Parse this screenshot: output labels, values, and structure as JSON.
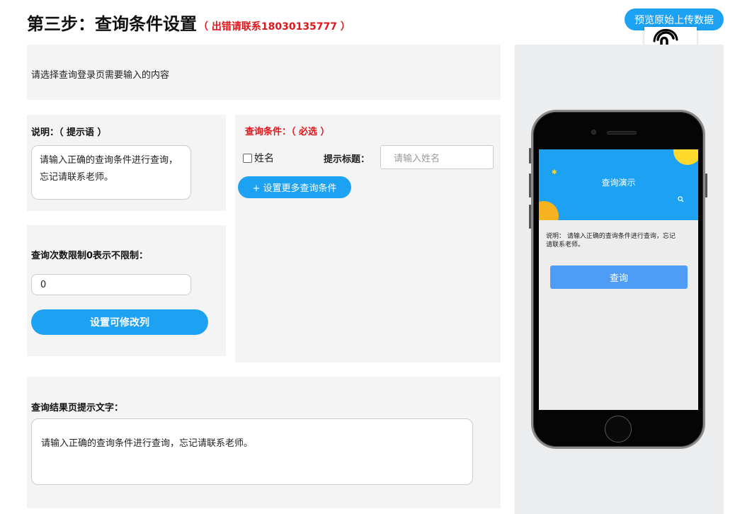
{
  "header": {
    "title": "第三步：查询条件设置",
    "note": "（ 出错请联系18030135777 ）",
    "preview_button": "预览原始上传数据"
  },
  "intro": {
    "text": "请选择查询登录页需要输入的内容"
  },
  "description": {
    "label": "说明：（ 提示语 ）",
    "value": "请输入正确的查询条件进行查询，忘记请联系老师。"
  },
  "limit": {
    "label": "查询次数限制0表示不限制：",
    "value": "0",
    "set_columns_button": "设置可修改列"
  },
  "conditions": {
    "title": "查询条件：（ 必选 ）",
    "items": [
      {
        "label": "姓名",
        "checked": false,
        "hint_label": "提示标题：",
        "placeholder": "请输入姓名"
      }
    ],
    "more_button": "+ 设置更多查询条件"
  },
  "result": {
    "label": "查询结果页提示文字：",
    "value": "请输入正确的查询条件进行查询，忘记请联系老师。"
  },
  "phone_preview": {
    "title": "查询演示",
    "description": "说明： 请输入正确的查询条件进行查询，忘记请联系老师。",
    "query_button": "查询"
  },
  "colors": {
    "primary": "#1da1f2",
    "danger": "#e0161b",
    "panel": "#f4f4f4",
    "phone_button": "#4e9cf6",
    "deco_yellow": "#ffd92b",
    "deco_orange": "#f7b21f"
  },
  "icons": [
    "hand-pointer-icon",
    "star-icon",
    "search-icon",
    "checkbox-icon"
  ]
}
